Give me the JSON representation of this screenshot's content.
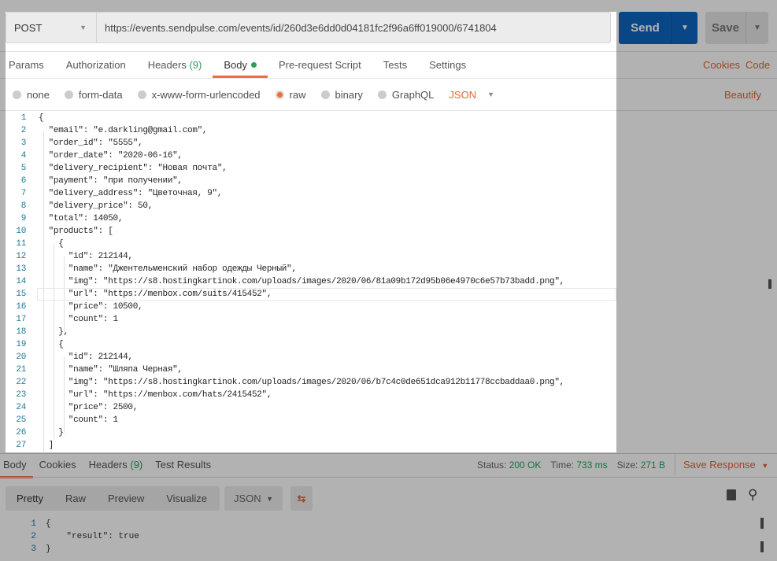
{
  "request": {
    "method": "POST",
    "url": "https://events.sendpulse.com/events/id/260d3e6dd0d04181fc2f96a6ff019000/6741804",
    "send_label": "Send",
    "save_label": "Save"
  },
  "tabs": [
    {
      "label": "Params"
    },
    {
      "label": "Authorization"
    },
    {
      "label": "Headers",
      "count": "(9)"
    },
    {
      "label": "Body",
      "active": true
    },
    {
      "label": "Pre-request Script"
    },
    {
      "label": "Tests"
    },
    {
      "label": "Settings"
    }
  ],
  "links": {
    "cookies": "Cookies",
    "code": "Code",
    "beautify": "Beautify"
  },
  "body_types": [
    "none",
    "form-data",
    "x-www-form-urlencoded",
    "raw",
    "binary",
    "GraphQL"
  ],
  "body_type_selected": "raw",
  "raw_format": "JSON",
  "body_lines": [
    "{",
    "  \"email\": \"e.darkling@gmail.com\",",
    "  \"order_id\": \"5555\",",
    "  \"order_date\": \"2020-06-16\",",
    "  \"delivery_recipient\": \"Новая почта\",",
    "  \"payment\": \"при получении\",",
    "  \"delivery_address\": \"Цветочная, 9\",",
    "  \"delivery_price\": 50,",
    "  \"total\": 14050,",
    "  \"products\": [",
    "    {",
    "      \"id\": 212144,",
    "      \"name\": \"Джентельменский набор одежды Черный\",",
    "      \"img\": \"https://s8.hostingkartinok.com/uploads/images/2020/06/81a09b172d95b06e4970c6e57b73badd.png\",",
    "      \"url\": \"https://menbox.com/suits/415452\",",
    "      \"price\": 10500,",
    "      \"count\": 1",
    "    },",
    "    {",
    "      \"id\": 212144,",
    "      \"name\": \"Шляпа Черная\",",
    "      \"img\": \"https://s8.hostingkartinok.com/uploads/images/2020/06/b7c4c0de651dca912b11778ccbaddaa0.png\",",
    "      \"url\": \"https://menbox.com/hats/2415452\",",
    "      \"price\": 2500,",
    "      \"count\": 1",
    "    }",
    "  ]"
  ],
  "response": {
    "tabs": [
      {
        "label": "Body",
        "active": true
      },
      {
        "label": "Cookies"
      },
      {
        "label": "Headers",
        "count": "(9)"
      },
      {
        "label": "Test Results"
      }
    ],
    "status_label": "Status:",
    "status": "200 OK",
    "time_label": "Time:",
    "time": "733 ms",
    "size_label": "Size:",
    "size": "271 B",
    "save_response": "Save Response",
    "views": [
      "Pretty",
      "Raw",
      "Preview",
      "Visualize"
    ],
    "format": "JSON",
    "lines": [
      "{",
      "    \"result\": true",
      "}"
    ]
  },
  "colors": {
    "accent": "#f26b3a",
    "send": "#0d65c0",
    "success": "#26a05a",
    "key": "#a31515",
    "string": "#0451a5",
    "number": "#098658"
  }
}
